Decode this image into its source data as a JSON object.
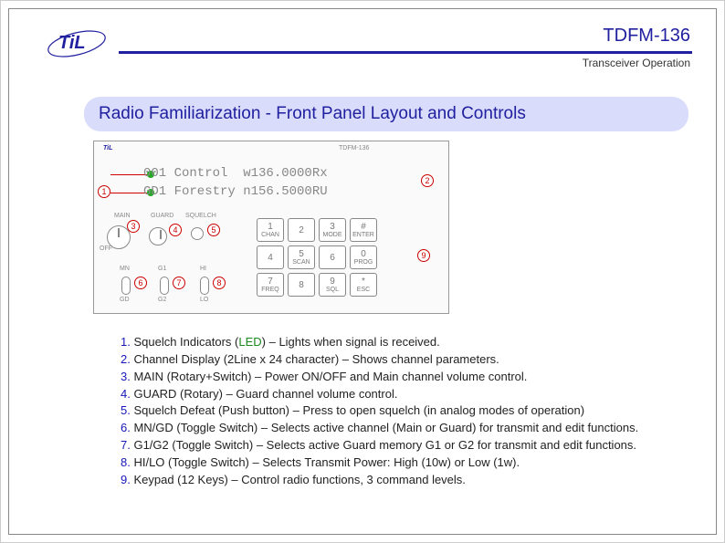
{
  "header": {
    "logo_text": "TiL",
    "model": "TDFM-136",
    "subtitle": "Transceiver Operation"
  },
  "title": "Radio Familiarization - Front Panel Layout and Controls",
  "diagram": {
    "brand_small": "TiL",
    "model_small": "TDFM-136",
    "lcd_line1": "001 Control  w136.0000Rx",
    "lcd_line2": "GD1 Forestry n156.5000RU",
    "main_label": "MAIN",
    "guard_label": "GUARD",
    "sq_label": "SQUELCH",
    "hi_label": "HI",
    "lo_label": "LO",
    "mn_label": "MN",
    "gd_label": "GD",
    "g1_label": "G1",
    "g2_label": "G2",
    "off_label": "OFF",
    "callouts": {
      "c1": "1",
      "c2": "2",
      "c3": "3",
      "c4": "4",
      "c5": "5",
      "c6": "6",
      "c7": "7",
      "c8": "8",
      "c9": "9"
    },
    "keys": [
      {
        "top": "1",
        "bot": "CHAN"
      },
      {
        "top": "2",
        "bot": ""
      },
      {
        "top": "3",
        "bot": "MODE"
      },
      {
        "top": "#",
        "bot": "ENTER"
      },
      {
        "top": "4",
        "bot": ""
      },
      {
        "top": "5",
        "bot": "SCAN"
      },
      {
        "top": "6",
        "bot": ""
      },
      {
        "top": "0",
        "bot": "PROG"
      },
      {
        "top": "7",
        "bot": "FREQ"
      },
      {
        "top": "8",
        "bot": ""
      },
      {
        "top": "9",
        "bot": "SQL"
      },
      {
        "top": "*",
        "bot": "ESC"
      }
    ]
  },
  "items": [
    {
      "n": "1.",
      "name": "Squelch Indicators (",
      "led": "LED",
      "rest": ") – Lights when signal is received."
    },
    {
      "n": "2.",
      "name": "Channel Display (2Line x 24 character) – Shows channel parameters.",
      "led": "",
      "rest": ""
    },
    {
      "n": "3.",
      "name": "MAIN (Rotary+Switch) – Power ON/OFF and Main channel volume control.",
      "led": "",
      "rest": ""
    },
    {
      "n": "4.",
      "name": "GUARD (Rotary) – Guard channel volume control.",
      "led": "",
      "rest": ""
    },
    {
      "n": "5.",
      "name": "Squelch Defeat (Push button) – Press to open squelch (in analog modes of operation)",
      "led": "",
      "rest": ""
    },
    {
      "n": "6.",
      "name": "MN/GD (Toggle Switch) – Selects active channel (Main or Guard) for transmit and edit functions.",
      "led": "",
      "rest": ""
    },
    {
      "n": "7.",
      "name": "G1/G2 (Toggle Switch) – Selects active Guard memory G1 or G2 for transmit and edit functions.",
      "led": "",
      "rest": ""
    },
    {
      "n": "8.",
      "name": "HI/LO (Toggle Switch) – Selects Transmit Power: High (10w) or Low (1w).",
      "led": "",
      "rest": ""
    },
    {
      "n": "9.",
      "name": "Keypad (12 Keys) – Control radio functions, 3 command levels.",
      "led": "",
      "rest": ""
    }
  ]
}
